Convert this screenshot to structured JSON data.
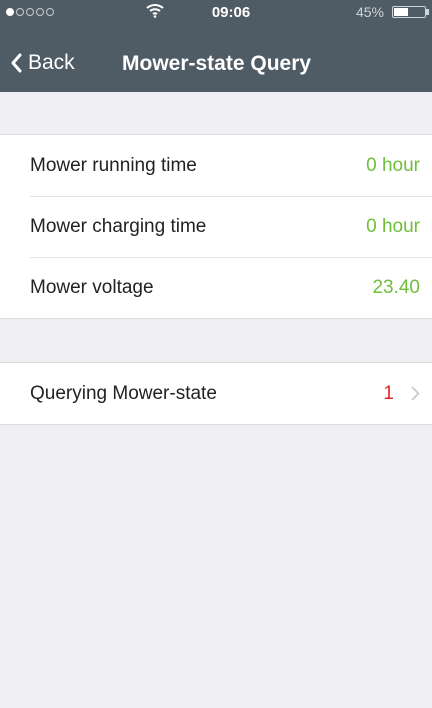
{
  "status_bar": {
    "time": "09:06",
    "battery_percent": "45%",
    "battery_level": 0.45,
    "signal_bars_filled": 1,
    "signal_bars_total": 5
  },
  "nav": {
    "back_label": "Back",
    "title": "Mower-state Query"
  },
  "stats": [
    {
      "label": "Mower running time",
      "value": "0  hour"
    },
    {
      "label": "Mower charging time",
      "value": "0  hour"
    },
    {
      "label": "Mower voltage",
      "value": "23.40"
    }
  ],
  "query": {
    "label": "Querying Mower-state",
    "count": "1"
  },
  "colors": {
    "header": "#4f5b65",
    "background": "#efeff4",
    "value_green": "#6fbf3a",
    "count_red": "#e0252b"
  }
}
